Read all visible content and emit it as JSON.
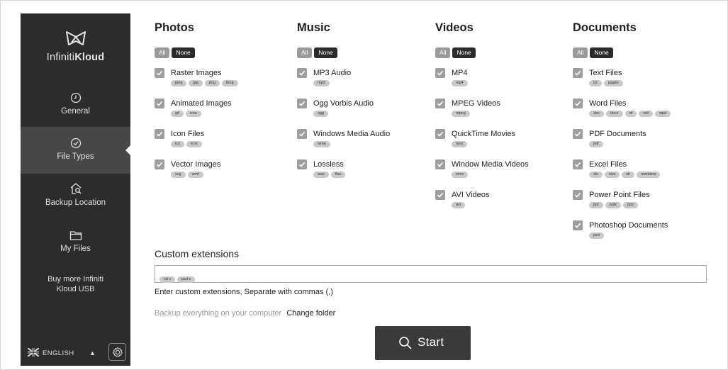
{
  "brand": {
    "name_light": "Infiniti",
    "name_bold": "Kloud"
  },
  "nav": [
    {
      "label": "General",
      "icon": "clock-icon"
    },
    {
      "label": "File Types",
      "icon": "check-circle-icon",
      "active": true
    },
    {
      "label": "Backup Location",
      "icon": "house-search-icon"
    },
    {
      "label": "My Files",
      "icon": "folder-icon"
    }
  ],
  "buy_more": {
    "line1": "Buy more Infiniti",
    "line2": "Kloud USB"
  },
  "footer": {
    "language": "ENGLISH",
    "caret": "▲"
  },
  "select_all_label": "All",
  "select_none_label": "None",
  "columns": [
    {
      "title": "Photos",
      "items": [
        {
          "label": "Raster Images",
          "checked": true,
          "tags": [
            "jpeg",
            "jpg",
            "png",
            "bmp"
          ]
        },
        {
          "label": "Animated Images",
          "checked": true,
          "tags": [
            "gif",
            "icns"
          ]
        },
        {
          "label": "Icon Files",
          "checked": true,
          "tags": [
            "ico",
            "icns"
          ]
        },
        {
          "label": "Vector Images",
          "checked": true,
          "tags": [
            "svg",
            "wmf"
          ]
        }
      ]
    },
    {
      "title": "Music",
      "items": [
        {
          "label": "MP3 Audio",
          "checked": true,
          "tags": [
            "mp3"
          ]
        },
        {
          "label": "Ogg Vorbis Audio",
          "checked": true,
          "tags": [
            "ogg"
          ]
        },
        {
          "label": "Windows Media Audio",
          "checked": true,
          "tags": [
            "wma"
          ]
        },
        {
          "label": "Lossless",
          "checked": true,
          "tags": [
            "wav",
            "flac"
          ]
        }
      ]
    },
    {
      "title": "Videos",
      "items": [
        {
          "label": "MP4",
          "checked": true,
          "tags": [
            "mp4"
          ]
        },
        {
          "label": "MPEG Videos",
          "checked": true,
          "tags": [
            "mpeg"
          ]
        },
        {
          "label": "QuickTime Movies",
          "checked": true,
          "tags": [
            "mov"
          ]
        },
        {
          "label": "Window Media Videos",
          "checked": true,
          "tags": [
            "wmv"
          ]
        },
        {
          "label": "AVI Videos",
          "checked": true,
          "tags": [
            "avi"
          ]
        }
      ]
    },
    {
      "title": "Documents",
      "items": [
        {
          "label": "Text Files",
          "checked": true,
          "tags": [
            "txt",
            "pages"
          ]
        },
        {
          "label": "Word Files",
          "checked": true,
          "tags": [
            "doc",
            "docx",
            "rtf",
            "odt",
            "wpd"
          ]
        },
        {
          "label": "PDF Documents",
          "checked": true,
          "tags": [
            "pdf"
          ]
        },
        {
          "label": "Excel Files",
          "checked": true,
          "tags": [
            "xls",
            "xlsx",
            "slr",
            "numbers"
          ]
        },
        {
          "label": "Power Point Files",
          "checked": true,
          "tags": [
            "ppt",
            "pptx",
            "pps"
          ]
        },
        {
          "label": "Photoshop Documents",
          "checked": true,
          "tags": [
            "psd"
          ]
        }
      ]
    }
  ],
  "custom_extensions": {
    "title": "Custom extensions",
    "tags": [
      "xd x",
      "psd x"
    ],
    "hint": "Enter custom extensions, Separate with commas (,)"
  },
  "backup": {
    "text": "Backup everything on your computer",
    "link": "Change folder"
  },
  "start_label": "Start",
  "colors": {
    "sidebar": "#2c2c2c",
    "sidebar_active": "#474747",
    "checkbox": "#9e9e9e",
    "button": "#3a3a3a"
  }
}
